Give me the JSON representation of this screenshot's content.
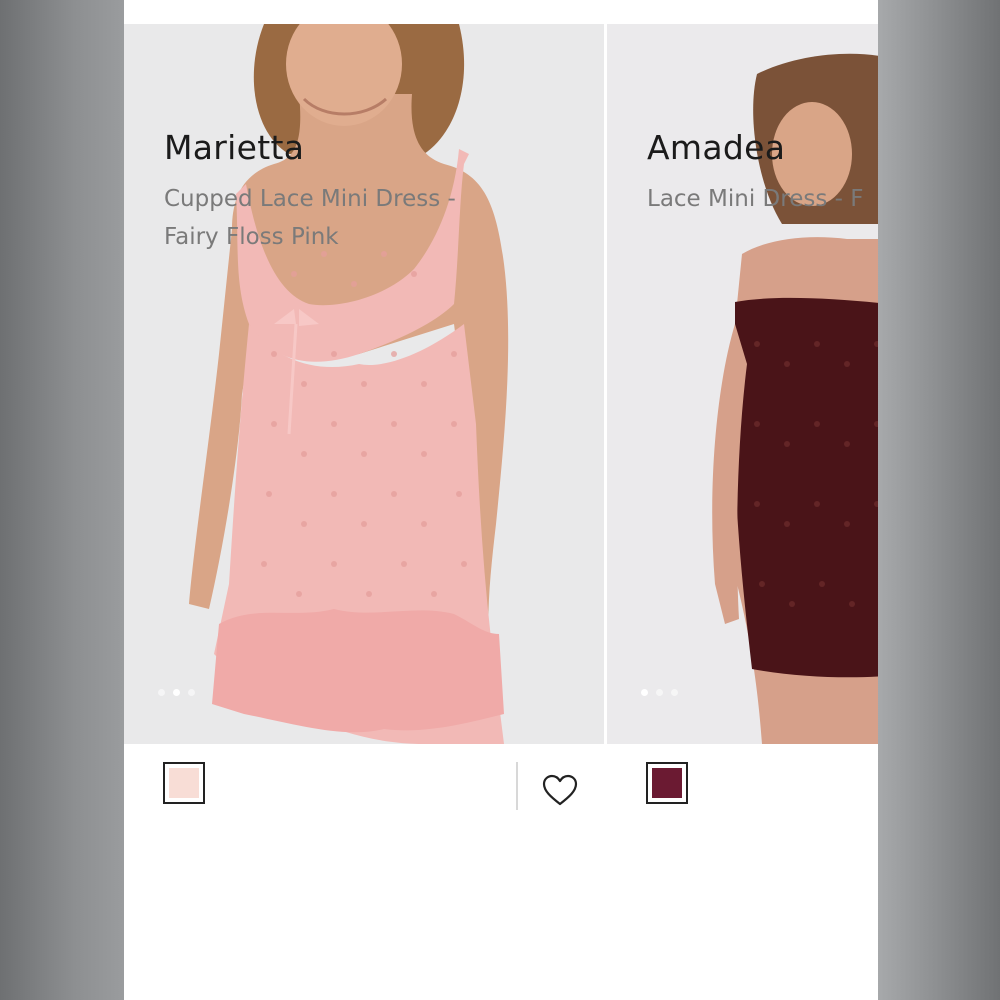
{
  "products": [
    {
      "name": "Marietta",
      "description": "Cupped Lace Mini Dress -\nFairy Floss Pink",
      "swatch_color": "#f8ddd6",
      "dress_color": "#f2b9b6",
      "carousel_dots": 3,
      "active_dot": 1
    },
    {
      "name": "Amadea",
      "description": "Lace Mini Dress - F",
      "swatch_color": "#6b1a32",
      "dress_color": "#4a1418",
      "carousel_dots": 3,
      "active_dot": 0
    }
  ],
  "icons": {
    "wishlist": "heart-outline-icon"
  }
}
